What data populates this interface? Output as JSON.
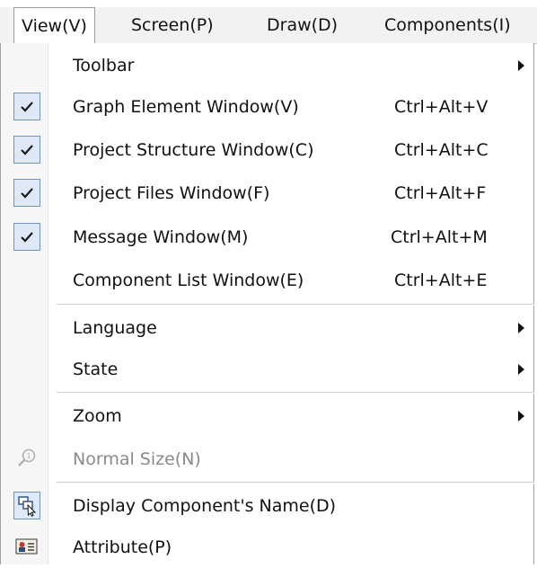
{
  "menubar": {
    "items": [
      {
        "label": "View(V)",
        "active": true
      },
      {
        "label": "Screen(P)"
      },
      {
        "label": "Draw(D)"
      },
      {
        "label": "Components(I)"
      }
    ]
  },
  "menu": {
    "toolbar": {
      "label": "Toolbar",
      "submenu": true
    },
    "graph_element": {
      "label": "Graph Element Window(V)",
      "shortcut": "Ctrl+Alt+V",
      "checked": true
    },
    "project_structure": {
      "label": "Project Structure Window(C)",
      "shortcut": "Ctrl+Alt+C",
      "checked": true
    },
    "project_files": {
      "label": "Project Files Window(F)",
      "shortcut": "Ctrl+Alt+F",
      "checked": true
    },
    "message_window": {
      "label": "Message Window(M)",
      "shortcut": "Ctrl+Alt+M",
      "checked": true
    },
    "component_list": {
      "label": "Component List Window(E)",
      "shortcut": "Ctrl+Alt+E",
      "checked": false
    },
    "language": {
      "label": "Language",
      "submenu": true
    },
    "state": {
      "label": "State",
      "submenu": true
    },
    "zoom": {
      "label": "Zoom",
      "submenu": true
    },
    "normal_size": {
      "label": "Normal Size(N)",
      "disabled": true,
      "icon": "zoom-magnifier-icon"
    },
    "display_component_name": {
      "label": "Display Component's Name(D)",
      "checked": true,
      "icon": "component-name-icon"
    },
    "attribute": {
      "label": "Attribute(P)",
      "icon": "attribute-card-icon"
    }
  },
  "colors": {
    "check_bg": "#dfe9f6",
    "check_border": "#6f93c6",
    "menubar_bg": "#f2f2f2",
    "gutter_bg": "#f6f6f6",
    "disabled_text": "#8a8a8a"
  }
}
